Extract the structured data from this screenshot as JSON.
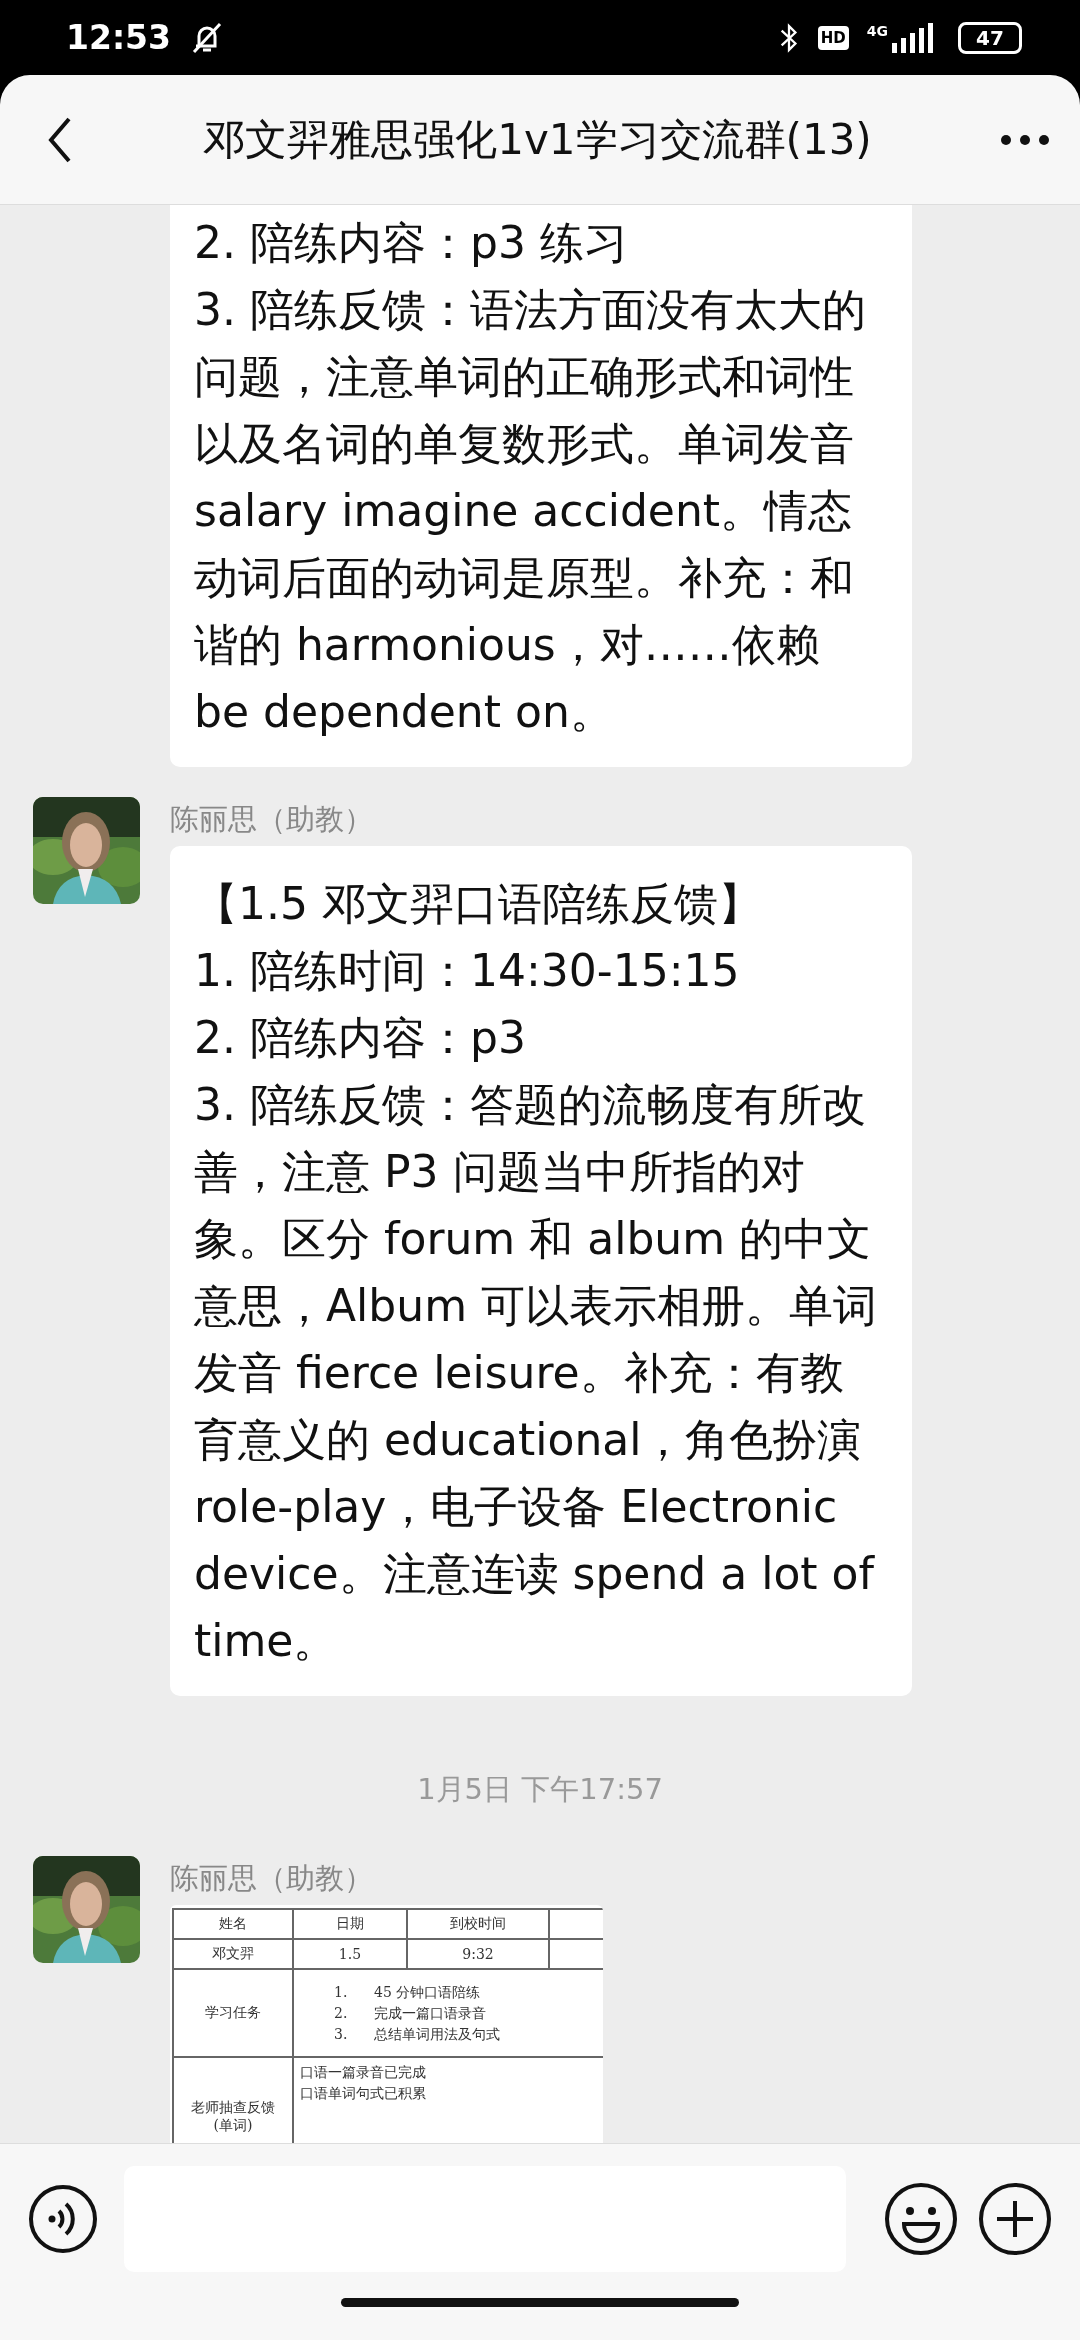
{
  "status_bar": {
    "time": "12:53",
    "network_badge": "HD",
    "network_type": "4G",
    "battery": "47"
  },
  "header": {
    "title": "邓文羿雅思强化1v1学习交流群(13)"
  },
  "messages": [
    {
      "kind": "text",
      "lines": [
        "2. 陪练内容：p3 练习",
        "3. 陪练反馈：语法方面没有太大的问题，注意单词的正确形式和词性以及名词的单复数形式。单词发音 salary imagine accident。情态动词后面的动词是原型。补充：和谐的 harmonious，对……依赖 be dependent on。"
      ]
    },
    {
      "kind": "text",
      "sender": "陈丽思（助教）",
      "lines": [
        "【1.5 邓文羿口语陪练反馈】",
        "1. 陪练时间：14:30-15:15",
        "2. 陪练内容：p3",
        "3. 陪练反馈：答题的流畅度有所改善，注意 P3 问题当中所指的对象。区分 forum 和 album 的中文意思，Album 可以表示相册。单词发音 fierce leisure。补充：有教育意义的 educational，角色扮演 role-play，电子设备 Electronic device。注意连读 spend a lot of time。"
      ]
    },
    {
      "kind": "time",
      "text": "1月5日 下午17:57"
    },
    {
      "sender": "陈丽思（助教）",
      "table": {
        "rows": [
          {
            "kind": "grid",
            "cells": [
              {
                "lines": [
                  "姓名"
                ]
              },
              {
                "lines": [
                  "日期"
                ]
              },
              {
                "lines": [
                  "到校时间"
                ]
              },
              {}
            ]
          },
          {
            "kind": "grid",
            "cells": [
              {
                "lines": [
                  "邓文羿"
                ]
              },
              {
                "lines": [
                  "1.5"
                ]
              },
              {
                "lines": [
                  "9:32"
                ]
              },
              {}
            ]
          },
          {
            "kind": "tasks",
            "cells": [
              {
                "lines": [
                  "学习任务"
                ]
              },
              {
                "lines": [
                  "1.      45 分钟口语陪练",
                  "2.      完成一篇口语录音",
                  "3.      总结单词用法及句式"
                ],
                "colspan": 3
              }
            ]
          },
          {
            "kind": "wide",
            "cells": [
              {
                "lines": [
                  "老师抽查反馈",
                  "(单词)"
                ]
              },
              {
                "lines": [
                  "口语一篇录音已完成",
                  "口语单词句式已积累"
                ],
                "colspan": 3
              }
            ]
          }
        ]
      }
    }
  ]
}
